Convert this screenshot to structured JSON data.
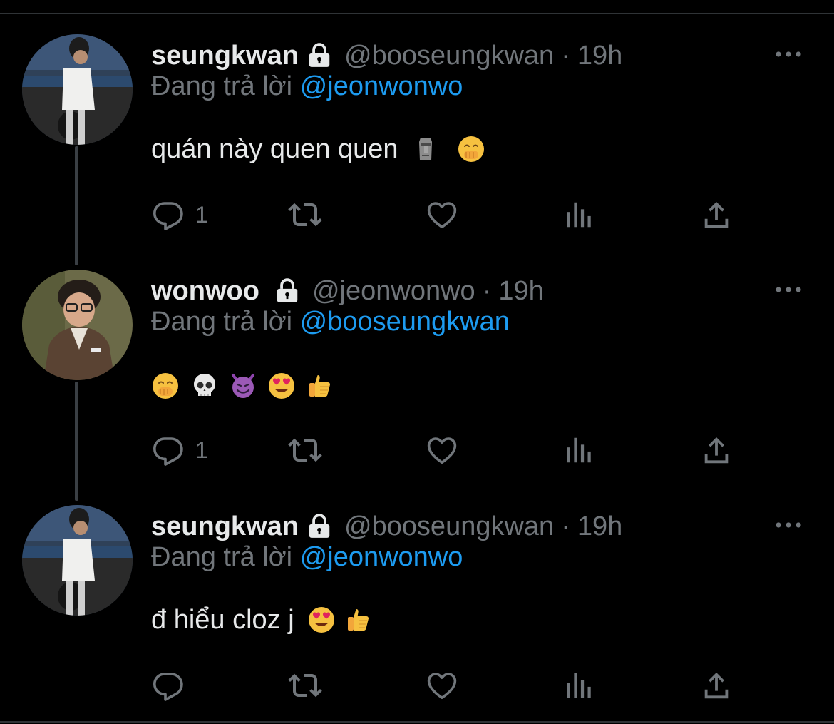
{
  "colors": {
    "background": "#000000",
    "text": "#e7e9ea",
    "secondary": "#71767b",
    "link": "#1d9bf0",
    "divider": "#2f3336"
  },
  "tweets": [
    {
      "name": "seungkwan",
      "handle": "@booseungkwan",
      "dot": "·",
      "time": "19h",
      "reply_prefix": "Đang trả lời",
      "reply_to": "@jeonwonwo",
      "text": "quán này quen quen",
      "emojis": [
        "moai-emoji",
        "face-with-hand-over-mouth-emoji"
      ],
      "reply_count": "1",
      "avatar": "avatar-seungkwan-beach"
    },
    {
      "name": "wonwoo",
      "handle": "@jeonwonwo",
      "dot": "·",
      "time": "19h",
      "reply_prefix": "Đang trả lời",
      "reply_to": "@booseungkwan",
      "text": "",
      "emojis": [
        "face-with-hand-over-mouth-emoji",
        "skull-emoji",
        "smiling-devil-emoji",
        "heart-eyes-emoji",
        "thumbs-up-emoji"
      ],
      "reply_count": "1",
      "avatar": "avatar-wonwoo-glasses"
    },
    {
      "name": "seungkwan",
      "handle": "@booseungkwan",
      "dot": "·",
      "time": "19h",
      "reply_prefix": "Đang trả lời",
      "reply_to": "@jeonwonwo",
      "text": "đ hiểu cloz j",
      "emojis": [
        "heart-eyes-emoji",
        "thumbs-up-emoji"
      ],
      "reply_count": "",
      "avatar": "avatar-seungkwan-beach"
    }
  ],
  "action_icons": [
    "reply-icon",
    "retweet-icon",
    "like-icon",
    "views-icon",
    "share-icon"
  ]
}
